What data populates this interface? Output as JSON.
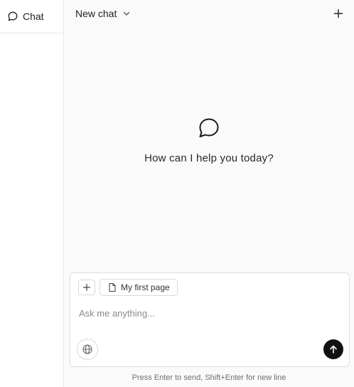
{
  "sidebar": {
    "tab_label": "Chat",
    "tab_icon": "chat-bubble-icon"
  },
  "header": {
    "title": "New chat",
    "title_icon": "chevron-down-icon",
    "new_icon": "plus-icon"
  },
  "empty_state": {
    "icon": "chat-bubble-icon",
    "prompt": "How can I help you today?"
  },
  "composer": {
    "attach_icon": "plus-icon",
    "context_chip": {
      "label": "My first page",
      "icon": "document-icon"
    },
    "input_placeholder": "Ask me anything...",
    "input_value": "",
    "web_icon": "globe-icon",
    "send_icon": "arrow-up-icon",
    "hint": "Press Enter to send, Shift+Enter for new line"
  },
  "colors": {
    "main_background": "#fafafa",
    "border": "#e6e6e6",
    "send_button": "#111111"
  }
}
